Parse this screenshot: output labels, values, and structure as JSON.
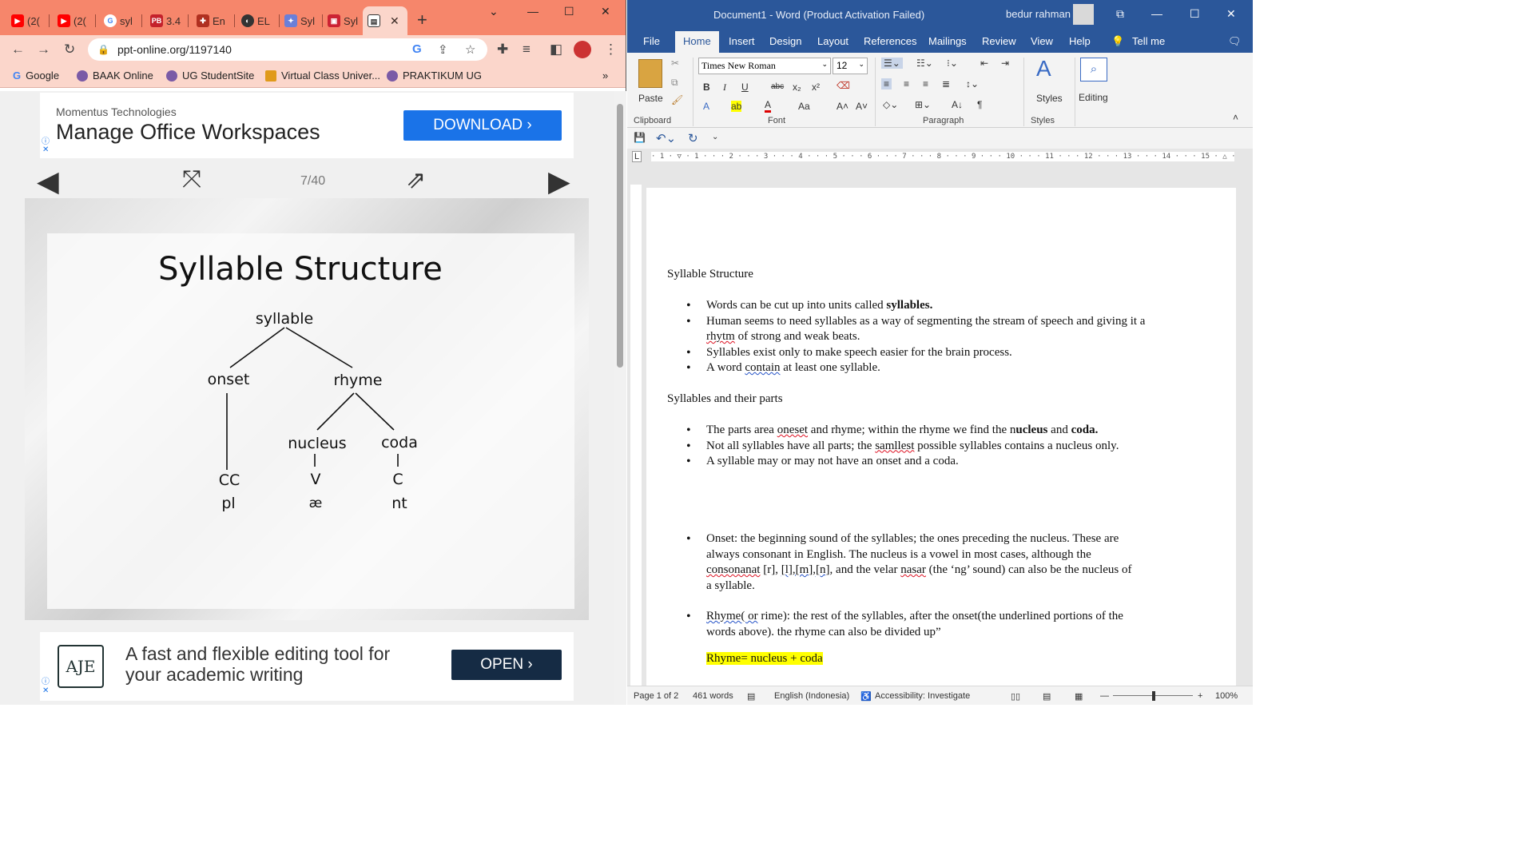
{
  "browser": {
    "tabs": [
      {
        "label": "(2(",
        "icon": "youtube-icon",
        "color": "#ff0000"
      },
      {
        "label": "(2(",
        "icon": "youtube-icon",
        "color": "#ff0000"
      },
      {
        "label": "syl",
        "icon": "google-icon",
        "color": "#4285f4"
      },
      {
        "label": "3.4",
        "icon": "pb-icon",
        "color": "#c4212b"
      },
      {
        "label": "En",
        "icon": "grid-icon",
        "color": "#b03020"
      },
      {
        "label": "EL",
        "icon": "globe-icon",
        "color": "#333333"
      },
      {
        "label": "Syl",
        "icon": "sparkle-icon",
        "color": "#6a7fd8"
      },
      {
        "label": "Syl",
        "icon": "slides-icon",
        "color": "#c23"
      }
    ],
    "active_tab_close": "✕",
    "url": "ppt-online.org/1197140",
    "bookmarks": [
      {
        "label": "Google",
        "icon": "google-icon"
      },
      {
        "label": "BAAK Online",
        "icon": "ug-icon"
      },
      {
        "label": "UG StudentSite",
        "icon": "ug-icon"
      },
      {
        "label": "Virtual Class Univer...",
        "icon": "vclass-icon"
      },
      {
        "label": "PRAKTIKUM UG",
        "icon": "ug-icon"
      }
    ],
    "bookmarks_overflow": "»",
    "accent": "#f6866b"
  },
  "page": {
    "ad_top": {
      "sponsor": "Momentus Technologies",
      "headline": "Manage Office Workspaces",
      "cta": "DOWNLOAD ›"
    },
    "slide_counter": "7/40",
    "slide": {
      "title": "Syllable Structure",
      "tree": {
        "root": "syllable",
        "onset": "onset",
        "rhyme": "rhyme",
        "nucleus": "nucleus",
        "coda": "coda",
        "onset_cv": "CC",
        "nucleus_cv": "V",
        "coda_cv": "C",
        "onset_seg": "pl",
        "nucleus_seg": "æ",
        "coda_seg": "nt"
      }
    },
    "ad_bottom": {
      "logo": "AJE",
      "text": "A fast and flexible editing tool for your academic writing",
      "cta": "OPEN ›"
    }
  },
  "word": {
    "title": "Document1  -  Word (Product Activation Failed)",
    "user": "bedur rahman",
    "menu": [
      "File",
      "Home",
      "Insert",
      "Design",
      "Layout",
      "References",
      "Mailings",
      "Review",
      "View",
      "Help",
      "Tell me"
    ],
    "ribbon": {
      "paste": "Paste",
      "font_name": "Times New Roman",
      "font_size": "12",
      "styles": "Styles",
      "editing": "Editing",
      "group_clipboard": "Clipboard",
      "group_font": "Font",
      "group_paragraph": "Paragraph",
      "group_styles": "Styles"
    },
    "ruler": "· 1 · ▽ · 1 · · · 2 · · · 3 · · · 4 · · · 5 · · · 6 · · · 7 · · · 8 · · · 9 · · · 10 · · · 11 · · · 12 · · · 13 · · · 14 · · · 15 · △ · · · · 17 · · · 18 ·",
    "doc": {
      "heading1": "Syllable Structure",
      "list1": [
        {
          "pre": "Words can be cut up into units called ",
          "bold": "syllables."
        },
        {
          "text_a": "Human seems to need syllables as a way of segmenting the stream of speech and giving it a ",
          "err": "rhytm",
          "text_b": " of strong and weak beats."
        },
        {
          "text": "Syllables exist only to make speech easier for the brain process."
        },
        {
          "text_a": "A word ",
          "err": "contain",
          "text_b": " at least one syllable."
        }
      ],
      "heading2": "Syllables and their parts",
      "list2": [
        {
          "text_a": "The parts area ",
          "err": "oneset",
          "text_b": " and rhyme; within the rhyme we find the n",
          "bold1": "ucleus",
          "text_c": " and ",
          "bold2": "coda."
        },
        {
          "text_a": "Not all syllables have all parts; the ",
          "err": "samllest",
          "text_b": " possible syllables contains a nucleus only."
        },
        {
          "text": "A syllable may or may not have an onset and a coda."
        }
      ],
      "list3": [
        {
          "text_a": "Onset: the beginning sound of the syllables; the ones preceding the nucleus. These are always consonant in English. The nucleus is a vowel in most cases, although the ",
          "err1": "consonanat",
          "text_b": " [r], ",
          "err2": "[l],[m],[n]",
          "text_c": ", and the velar ",
          "err3": "nasar",
          "text_d": " (the ‘ng’ sound) can also be the nucleus of a syllable."
        },
        {
          "err": "Rhyme( or",
          "text": " rime): the rest of the syllables, after the onset(the underlined portions of the words above). the rhyme can also be divided up”"
        }
      ],
      "highlight": "Rhyme= nucleus + coda"
    },
    "status": {
      "page": "Page 1 of 2",
      "words": "461 words",
      "lang": "English (Indonesia)",
      "access": "Accessibility: Investigate",
      "zoom": "100%"
    }
  }
}
